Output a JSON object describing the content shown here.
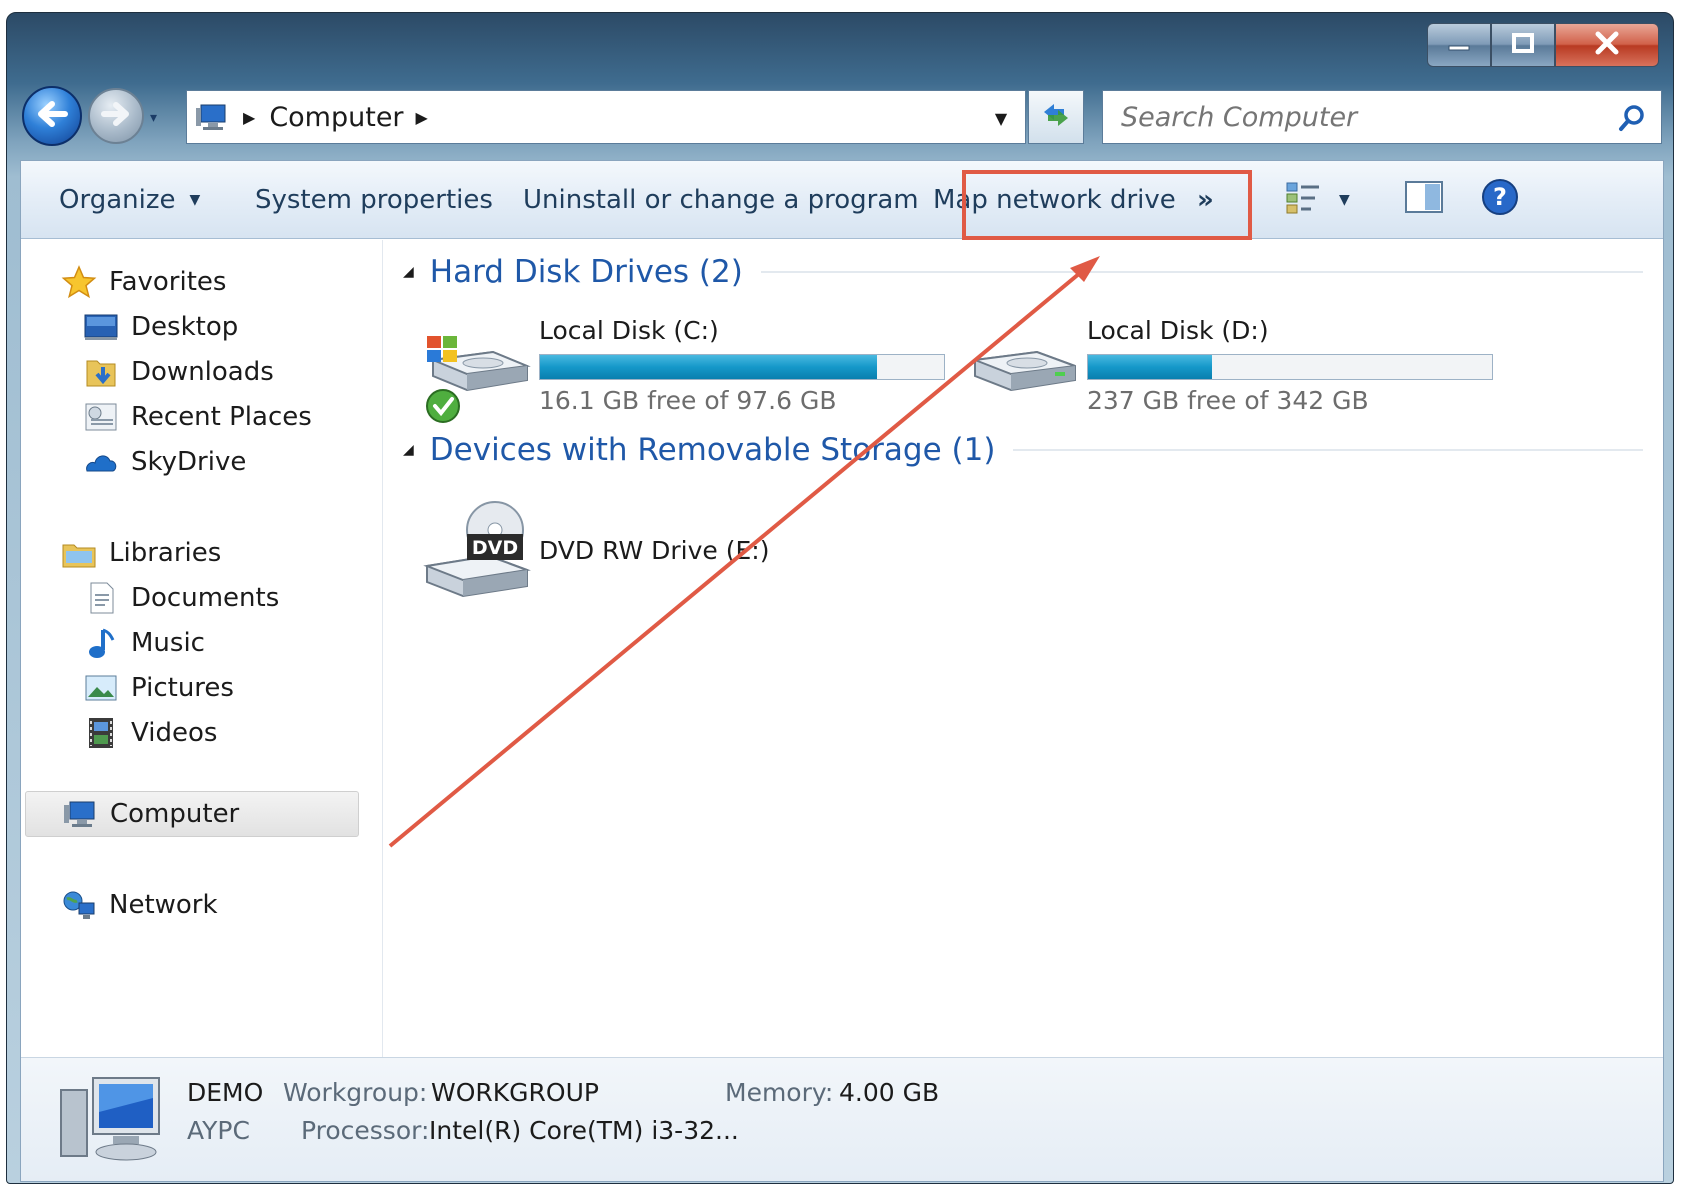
{
  "window": {
    "caption_buttons": {
      "minimize_icon": "minimize-icon",
      "maximize_icon": "maximize-icon",
      "close_icon": "close-icon"
    }
  },
  "navigation": {
    "back_icon": "back-arrow-icon",
    "forward_icon": "forward-arrow-icon",
    "address": {
      "location": "Computer",
      "separator": "▶"
    },
    "refresh_icon": "refresh-icon",
    "search": {
      "placeholder": "Search Computer",
      "icon": "search-icon"
    }
  },
  "toolbar": {
    "organize": "Organize",
    "system_properties": "System properties",
    "uninstall": "Uninstall or change a program",
    "map_network_drive": "Map network drive",
    "more": "»",
    "view_icon": "change-view-icon",
    "preview_icon": "preview-pane-icon",
    "help_icon": "help-icon"
  },
  "sidebar": {
    "favorites": {
      "label": "Favorites",
      "items": [
        {
          "label": "Desktop",
          "icon": "desktop-icon"
        },
        {
          "label": "Downloads",
          "icon": "downloads-icon"
        },
        {
          "label": "Recent Places",
          "icon": "recent-places-icon"
        },
        {
          "label": "SkyDrive",
          "icon": "skydrive-icon"
        }
      ]
    },
    "libraries": {
      "label": "Libraries",
      "items": [
        {
          "label": "Documents",
          "icon": "documents-icon"
        },
        {
          "label": "Music",
          "icon": "music-icon"
        },
        {
          "label": "Pictures",
          "icon": "pictures-icon"
        },
        {
          "label": "Videos",
          "icon": "videos-icon"
        }
      ]
    },
    "computer": {
      "label": "Computer",
      "icon": "computer-icon"
    },
    "network": {
      "label": "Network",
      "icon": "network-icon"
    }
  },
  "content": {
    "hard_disk_group": "Hard Disk Drives (2)",
    "drives": [
      {
        "name": "Local Disk (C:)",
        "free_text": "16.1 GB free of 97.6 GB",
        "used_fraction": 0.835,
        "icon": "system-drive-icon"
      },
      {
        "name": "Local Disk (D:)",
        "free_text": "237 GB free of 342 GB",
        "used_fraction": 0.307,
        "icon": "hard-drive-icon"
      }
    ],
    "removable_group": "Devices with Removable Storage (1)",
    "dvd": {
      "name": "DVD RW Drive (E:)",
      "badge": "DVD",
      "icon": "dvd-drive-icon"
    }
  },
  "details": {
    "computer_name": "DEMO",
    "user_name": "AYPC",
    "workgroup_label": "Workgroup:",
    "workgroup_value": "WORKGROUP",
    "memory_label": "Memory:",
    "memory_value": "4.00 GB",
    "processor_label": "Processor:",
    "processor_value": "Intel(R) Core(TM) i3-32..."
  },
  "annotation": {
    "highlight_color": "#e05a45",
    "arrow_color": "#e05a45"
  },
  "colors": {
    "accent_link": "#1f58a8",
    "progress": "#1598c9"
  }
}
